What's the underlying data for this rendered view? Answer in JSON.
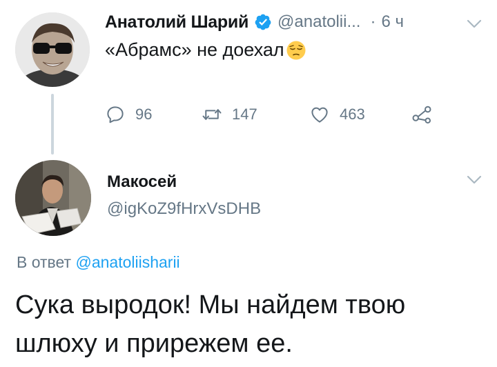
{
  "tweet1": {
    "author_name": "Анатолий Шарий",
    "handle": "@anatolii...",
    "separator": "·",
    "time": "6 ч",
    "text": "«Абрамс» не доехал",
    "emoji": "pensive-face-emoji",
    "reply_count": "96",
    "retweet_count": "147",
    "like_count": "463"
  },
  "tweet2": {
    "author_name": "Макосей",
    "handle": "@igKoZ9fHrxVsDHB",
    "reply_prefix": "В ответ ",
    "reply_mention": "@anatoliisharii",
    "text": "Сука выродок! Мы найдем твою шлюху и прирежем ее."
  },
  "colors": {
    "primary_text": "#14171a",
    "secondary_text": "#657786",
    "link": "#1da1f2",
    "verified": "#1da1f2",
    "thread_line": "#ccd6dd"
  },
  "icons": [
    "verified-badge-icon",
    "chevron-down-icon",
    "reply-icon",
    "retweet-icon",
    "like-heart-icon",
    "share-icon"
  ]
}
